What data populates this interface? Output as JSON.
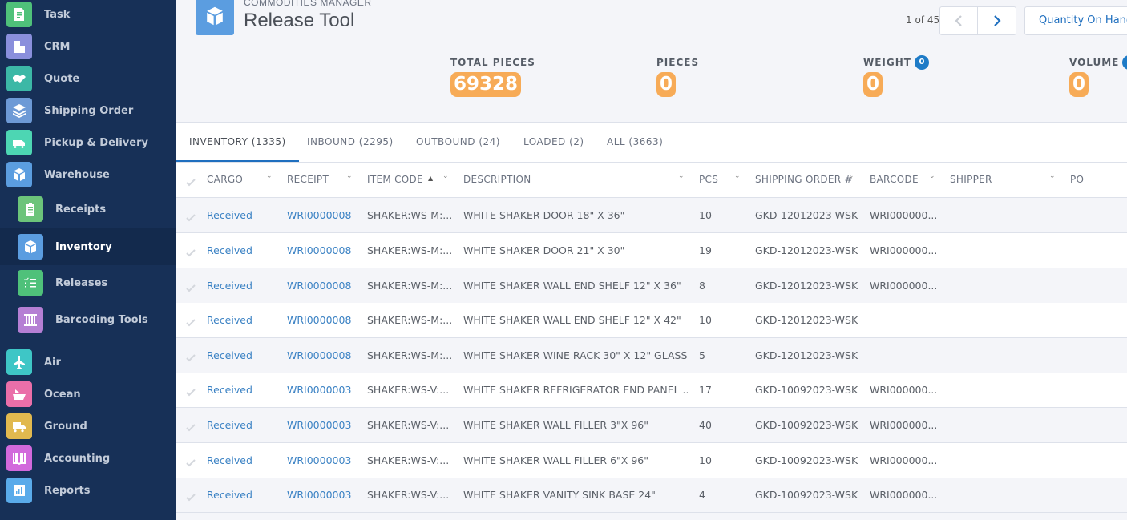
{
  "sidebar": {
    "items": [
      {
        "label": "Task",
        "icon": "task-icon",
        "color": "#4fc17a"
      },
      {
        "label": "CRM",
        "icon": "buildings-icon",
        "color": "#8a8fdc"
      },
      {
        "label": "Quote",
        "icon": "handshake-icon",
        "color": "#3cb8a6"
      },
      {
        "label": "Shipping Order",
        "icon": "layers-icon",
        "color": "#6d9ad6"
      },
      {
        "label": "Pickup & Delivery",
        "icon": "van-icon",
        "color": "#4dd6b3"
      },
      {
        "label": "Warehouse",
        "icon": "cube-icon",
        "color": "#5b9de0"
      },
      {
        "label": "Receipts",
        "icon": "clipboard-icon",
        "color": "#6cc47a"
      },
      {
        "label": "Inventory",
        "icon": "cube-icon",
        "color": "#5b9de0"
      },
      {
        "label": "Releases",
        "icon": "checklist-icon",
        "color": "#4fc17a"
      },
      {
        "label": "Barcoding Tools",
        "icon": "barcode-icon",
        "color": "#b57fd4"
      },
      {
        "label": "Air",
        "icon": "plane-icon",
        "color": "#3ec6c6"
      },
      {
        "label": "Ocean",
        "icon": "ship-icon",
        "color": "#ea6fa9"
      },
      {
        "label": "Ground",
        "icon": "truck-icon",
        "color": "#e1b94f"
      },
      {
        "label": "Accounting",
        "icon": "book-icon",
        "color": "#d269dc"
      },
      {
        "label": "Reports",
        "icon": "bar-chart-icon",
        "color": "#5aabea"
      }
    ],
    "active": "Inventory"
  },
  "header": {
    "supertitle": "COMMODITIES MANAGER",
    "title": "Release Tool",
    "pager_text": "1 of 45",
    "view_button": "Quantity On Hand",
    "accent": "#1f6fbf"
  },
  "stats": [
    {
      "label": "TOTAL PIECES",
      "value": "69328",
      "badge": null
    },
    {
      "label": "PIECES",
      "value": "0",
      "badge": null
    },
    {
      "label": "WEIGHT",
      "value": "0",
      "badge": "0"
    },
    {
      "label": "VOLUME",
      "value": "0",
      "badge": "0"
    }
  ],
  "tabs": [
    {
      "label": "INVENTORY (1335)",
      "active": true
    },
    {
      "label": "INBOUND (2295)",
      "active": false
    },
    {
      "label": "OUTBOUND (24)",
      "active": false
    },
    {
      "label": "LOADED (2)",
      "active": false
    },
    {
      "label": "ALL (3663)",
      "active": false
    }
  ],
  "table": {
    "columns": [
      "CARGO",
      "RECEIPT",
      "ITEM CODE",
      "DESCRIPTION",
      "PCS",
      "SHIPPING ORDER #...",
      "BARCODE",
      "SHIPPER",
      "PO"
    ],
    "sort": {
      "column": "ITEM CODE",
      "direction": "asc"
    },
    "rows": [
      {
        "cargo": "Received",
        "receipt": "WRI0000008",
        "item_code": "SHAKER:WS-M:...",
        "description": "WHITE SHAKER DOOR 18\" X 36\"",
        "pcs": "10",
        "shipping_order": "GKD-12012023-WSK",
        "barcode": "WRI000000...",
        "shipper": "",
        "po": ""
      },
      {
        "cargo": "Received",
        "receipt": "WRI0000008",
        "item_code": "SHAKER:WS-M:...",
        "description": "WHITE SHAKER DOOR 21\" X 30\"",
        "pcs": "19",
        "shipping_order": "GKD-12012023-WSK",
        "barcode": "WRI000000...",
        "shipper": "",
        "po": ""
      },
      {
        "cargo": "Received",
        "receipt": "WRI0000008",
        "item_code": "SHAKER:WS-M:...",
        "description": "WHITE SHAKER WALL END SHELF 12\" X 36\"",
        "pcs": "8",
        "shipping_order": "GKD-12012023-WSK",
        "barcode": "WRI000000...",
        "shipper": "",
        "po": ""
      },
      {
        "cargo": "Received",
        "receipt": "WRI0000008",
        "item_code": "SHAKER:WS-M:...",
        "description": "WHITE SHAKER WALL END SHELF 12\" X 42\"",
        "pcs": "10",
        "shipping_order": "GKD-12012023-WSK",
        "barcode": "",
        "shipper": "",
        "po": ""
      },
      {
        "cargo": "Received",
        "receipt": "WRI0000008",
        "item_code": "SHAKER:WS-M:...",
        "description": "WHITE SHAKER WINE RACK 30\" X 12\" GLASS...",
        "pcs": "5",
        "shipping_order": "GKD-12012023-WSK",
        "barcode": "",
        "shipper": "",
        "po": ""
      },
      {
        "cargo": "Received",
        "receipt": "WRI0000003",
        "item_code": "SHAKER:WS-V:...",
        "description": "WHITE SHAKER REFRIGERATOR END PANEL ...",
        "pcs": "17",
        "shipping_order": "GKD-10092023-WSK",
        "barcode": "WRI000000...",
        "shipper": "",
        "po": ""
      },
      {
        "cargo": "Received",
        "receipt": "WRI0000003",
        "item_code": "SHAKER:WS-V:...",
        "description": "WHITE SHAKER WALL FILLER 3\"X 96\"",
        "pcs": "40",
        "shipping_order": "GKD-10092023-WSK",
        "barcode": "WRI000000...",
        "shipper": "",
        "po": ""
      },
      {
        "cargo": "Received",
        "receipt": "WRI0000003",
        "item_code": "SHAKER:WS-V:...",
        "description": "WHITE SHAKER WALL FILLER 6\"X 96\"",
        "pcs": "10",
        "shipping_order": "GKD-10092023-WSK",
        "barcode": "WRI000000...",
        "shipper": "",
        "po": ""
      },
      {
        "cargo": "Received",
        "receipt": "WRI0000003",
        "item_code": "SHAKER:WS-V:...",
        "description": "WHITE SHAKER VANITY SINK BASE 24\"",
        "pcs": "4",
        "shipping_order": "GKD-10092023-WSK",
        "barcode": "WRI000000...",
        "shipper": "",
        "po": ""
      }
    ]
  }
}
